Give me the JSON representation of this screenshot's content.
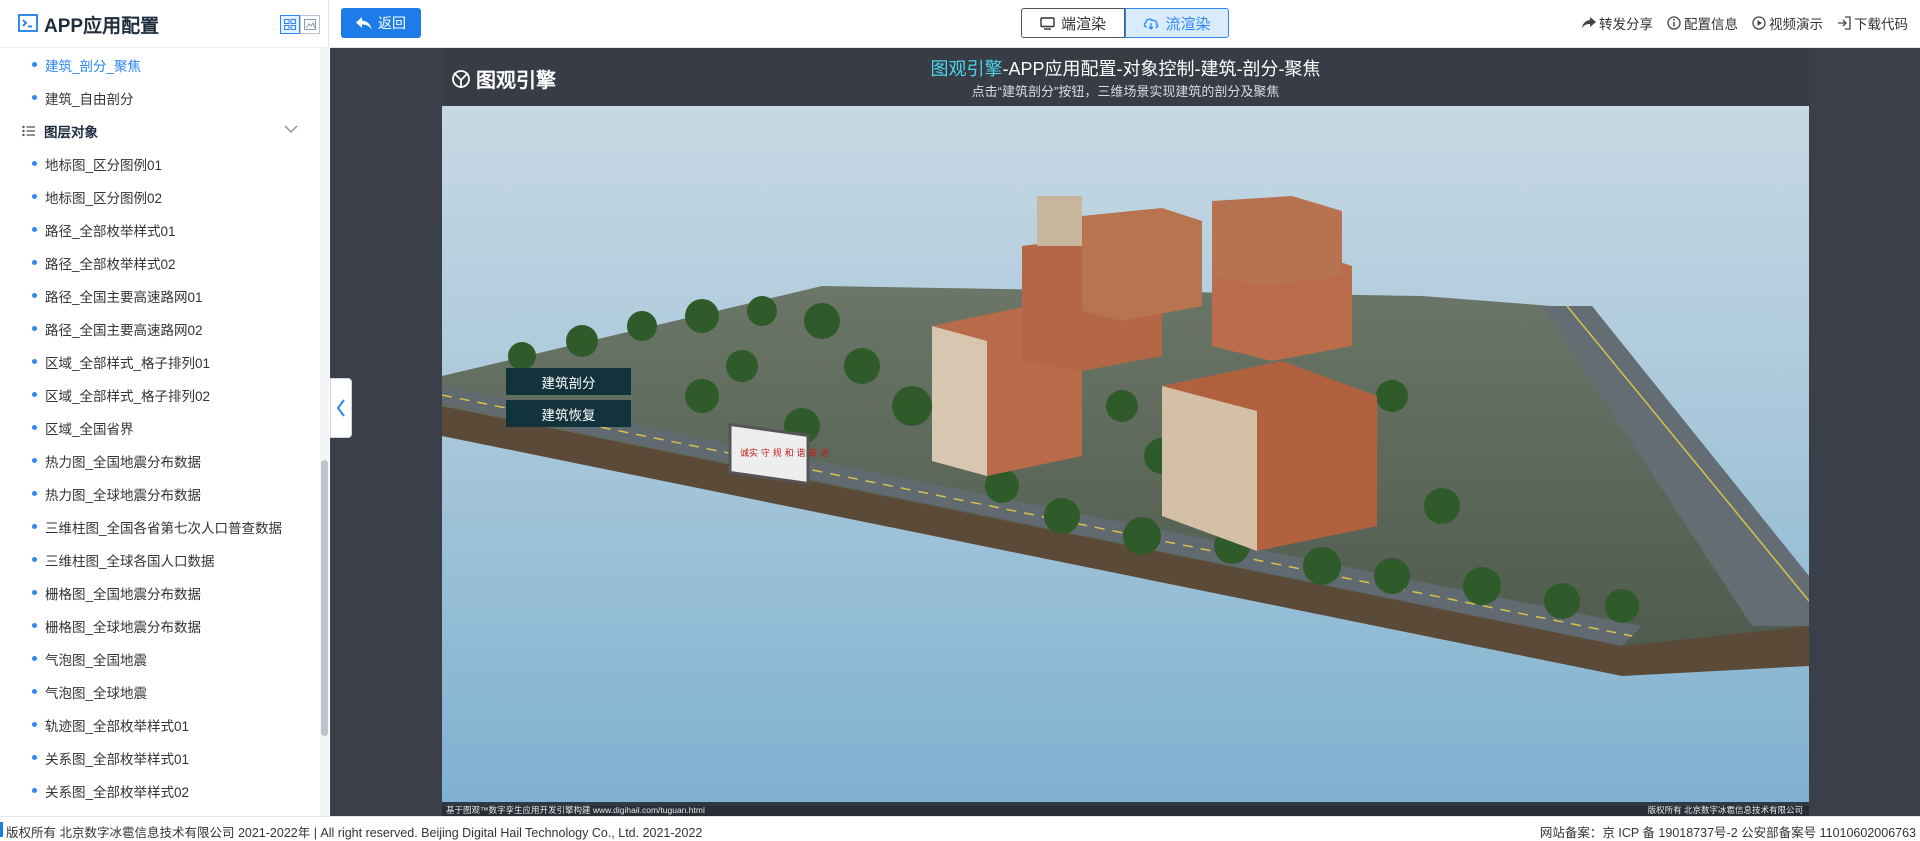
{
  "app": {
    "title": "APP应用配置",
    "icon": "terminal-window-icon"
  },
  "sidebar": {
    "items_top": [
      {
        "label": "建筑_剖分_聚焦",
        "active": true
      },
      {
        "label": "建筑_自由剖分",
        "active": false
      }
    ],
    "group": {
      "label": "图层对象",
      "icon": "list-icon",
      "expanded": true
    },
    "group_items": [
      "地标图_区分图例01",
      "地标图_区分图例02",
      "路径_全部枚举样式01",
      "路径_全部枚举样式02",
      "路径_全国主要高速路网01",
      "路径_全国主要高速路网02",
      "区域_全部样式_格子排列01",
      "区域_全部样式_格子排列02",
      "区域_全国省界",
      "热力图_全国地震分布数据",
      "热力图_全球地震分布数据",
      "三维柱图_全国各省第七次人口普查数据",
      "三维柱图_全球各国人口数据",
      "栅格图_全国地震分布数据",
      "栅格图_全球地震分布数据",
      "气泡图_全国地震",
      "气泡图_全球地震",
      "轨迹图_全部枚举样式01",
      "关系图_全部枚举样式01",
      "关系图_全部枚举样式02"
    ]
  },
  "toolbar": {
    "back_label": "返回",
    "render_end_label": "端渲染",
    "render_stream_label": "流渲染",
    "share_label": "转发分享",
    "config_label": "配置信息",
    "video_label": "视频演示",
    "download_label": "下载代码"
  },
  "scene": {
    "logo_text": "图观引擎",
    "title_brand": "图观引擎",
    "title_rest": "-APP应用配置-对象控制-建筑-剖分-聚焦",
    "subtitle": "点击“建筑剖分”按钮，三维场景实现建筑的剖分及聚焦",
    "btn_split": "建筑剖分",
    "btn_restore": "建筑恢复",
    "billboard_text": "诚实 守 规 和 谐 奋 进",
    "footer_left": "基于图观™数字孪生应用开发引擎构建 www.digihail.com/tuguan.html",
    "footer_right": "版权所有 北京数字冰雹信息技术有限公司"
  },
  "footer": {
    "copyright": "版权所有 北京数字冰雹信息技术有限公司 2021-2022年 | All right reserved. Beijing Digital Hail Technology Co., Ltd. 2021-2022",
    "icp": "网站备案：京 ICP 备 19018737号-2 公安部备案号 11010602006763"
  },
  "colors": {
    "accent": "#1e7ce8",
    "active_link": "#2f86f6",
    "scene_title_brand": "#4fd3f0",
    "scene_button_bg": "#13333c"
  }
}
